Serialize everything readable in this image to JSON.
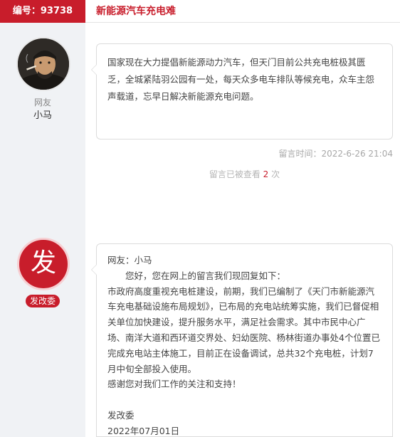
{
  "header": {
    "number_label": "编号：93738",
    "title": "新能源汽车充电难"
  },
  "message": {
    "user_role": "网友",
    "user_name": "小马",
    "text": "国家现在大力提倡新能源动力汽车，但天门目前公共充电桩极其匮乏，全城紧陆羽公园有一处，每天众多电车排队等候充电，众车主怨声载道，忘早日解决新能源充电问题。",
    "time": "留言时间：2022-6-26 21:04",
    "views_prefix": "留言已被查看",
    "views_count": "2",
    "views_suffix": "次"
  },
  "reply": {
    "dept_char": "发",
    "dept_name": "发改委",
    "lines": {
      "greeting": "网友：小马",
      "intro": "您好，您在网上的留言我们现回复如下：",
      "body": "市政府高度重视充电桩建设，前期，我们已编制了《天门市新能源汽车充电基础设施布局规划》，已布局的充电站统筹实施，我们已督促相关单位加快建设，提升服务水平，满足社会需求。其中市民中心广场、南洋大道和西环道交界处、妇幼医院、杨林街道办事处4个位置已完成充电站主体施工，目前正在设备调试，总共32个充电桩，计划7月中旬全部投入使用。",
      "thanks": "感谢您对我们工作的关注和支持！",
      "signature": "发改委",
      "date": "2022年07月01日"
    }
  }
}
